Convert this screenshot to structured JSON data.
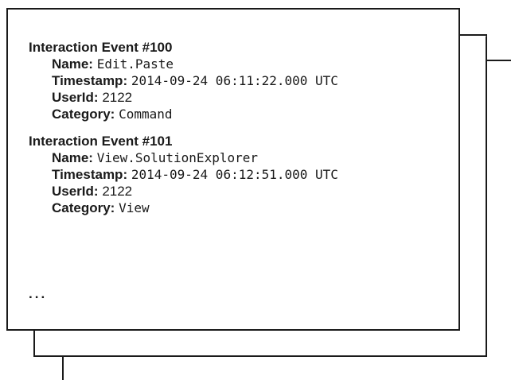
{
  "events": [
    {
      "title": "Interaction Event #100",
      "fields": [
        {
          "label": "Name:",
          "value": "Edit.Paste"
        },
        {
          "label": "Timestamp:",
          "value": "2014-09-24 06:11:22.000 UTC"
        },
        {
          "label": "UserId:",
          "value": "2122"
        },
        {
          "label": "Category:",
          "value": "Command"
        }
      ]
    },
    {
      "title": "Interaction Event #101",
      "fields": [
        {
          "label": "Name:",
          "value": "View.SolutionExplorer"
        },
        {
          "label": "Timestamp:",
          "value": "2014-09-24 06:12:51.000 UTC"
        },
        {
          "label": "UserId:",
          "value": "2122"
        },
        {
          "label": "Category:",
          "value": "View"
        }
      ]
    }
  ],
  "ellipsis": "..."
}
